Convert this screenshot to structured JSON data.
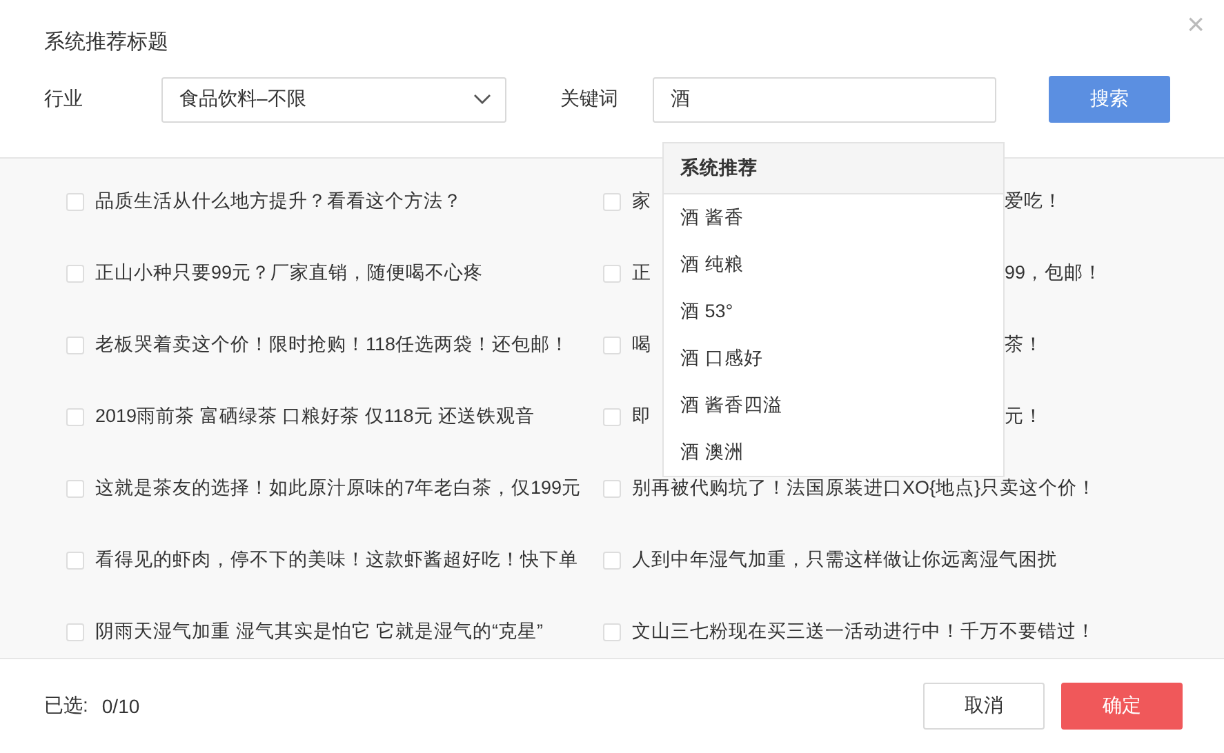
{
  "dialog": {
    "title": "系统推荐标题",
    "close": "×"
  },
  "filters": {
    "industry_label": "行业",
    "industry_value": "食品饮料–不限",
    "keyword_label": "关键词",
    "keyword_value": "酒",
    "search_button": "搜索"
  },
  "suggestions": {
    "header": "系统推荐",
    "items": [
      "酒 酱香",
      "酒 纯粮",
      "酒 53°",
      "酒 口感好",
      "酒 酱香四溢",
      "酒 澳洲"
    ]
  },
  "titles": {
    "left": [
      {
        "text": "品质生活从什么地方提升？看看这个方法？",
        "checked": false
      },
      {
        "text": "正山小种只要99元？厂家直销，随便喝不心疼",
        "checked": false
      },
      {
        "text": "老板哭着卖这个价！限时抢购！118任选两袋！还包邮！",
        "checked": false
      },
      {
        "text": "2019雨前茶 富硒绿茶 口粮好茶 仅118元 还送铁观音",
        "checked": false
      },
      {
        "text": "这就是茶友的选择！如此原汁原味的7年老白茶，仅199元",
        "checked": false
      },
      {
        "text": "看得见的虾肉，停不下的美味！这款虾酱超好吃！快下单",
        "checked": false
      },
      {
        "text": "阴雨天湿气加重 湿气其实是怕它 它就是湿气的“克星”",
        "checked": false
      }
    ],
    "right": [
      {
        "kind": "partly_hidden",
        "text_start": "家",
        "text_end": "爱吃！",
        "checked": false
      },
      {
        "kind": "partly_hidden",
        "text_start": "正",
        "text_end": "99，包邮！",
        "checked": false
      },
      {
        "kind": "partly_hidden",
        "text_start": "喝",
        "text_end": "茶！",
        "checked": false
      },
      {
        "kind": "partly_hidden",
        "text_start": "即",
        "text_end": "元！",
        "checked": false
      },
      {
        "kind": "full",
        "text": "别再被代购坑了！法国原装进口XO{地点}只卖这个价！",
        "checked": false
      },
      {
        "kind": "full",
        "text": "人到中年湿气加重，只需这样做让你远离湿气困扰",
        "checked": false
      },
      {
        "kind": "full",
        "text": "文山三七粉现在买三送一活动进行中！千万不要错过！",
        "checked": false
      }
    ]
  },
  "footer": {
    "selected_label": "已选:",
    "selected_count": "0/10",
    "cancel": "取消",
    "confirm": "确定"
  }
}
